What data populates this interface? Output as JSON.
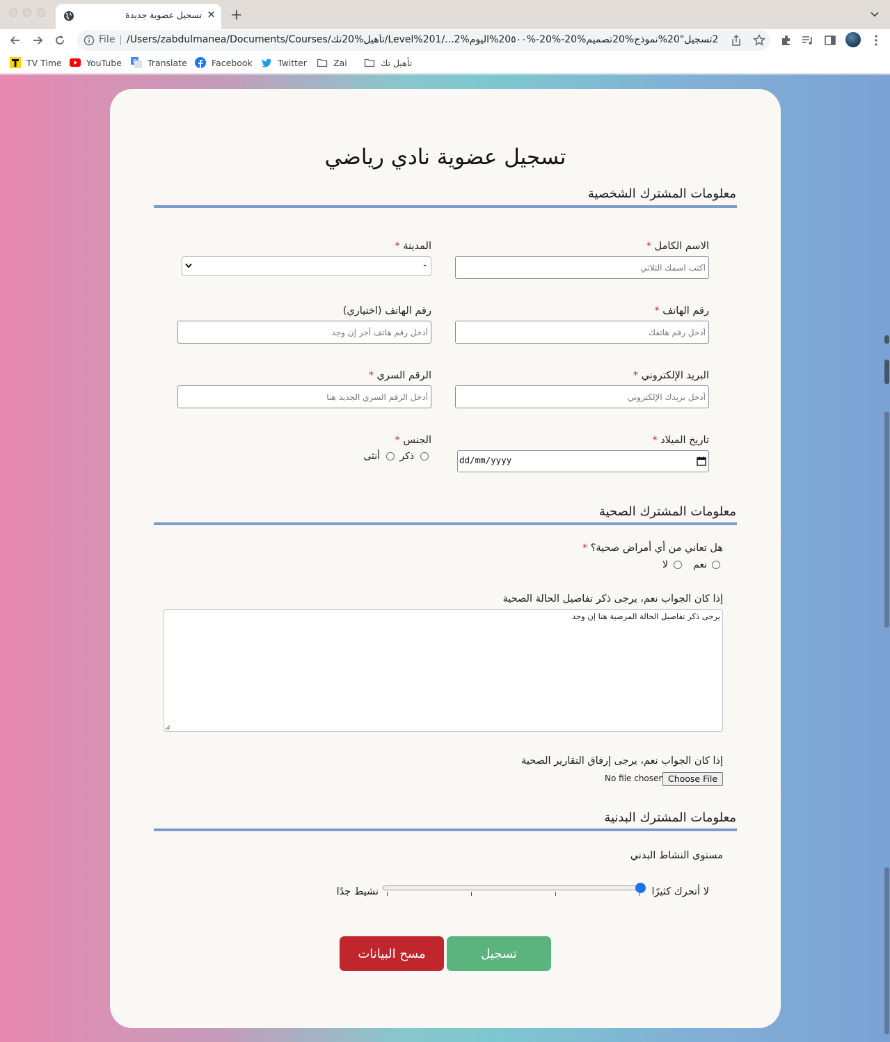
{
  "browser": {
    "tab_title": "تسجيل عضوية جديدة",
    "url_scheme": "File",
    "url": "/Users/zabdulmanea/Documents/Courses/تأهيل%20تك/Level%201/...2%عضوية%20تسجيل\"20%نموذج%20تصميم%20-%20-%20٥٠٠%اليوم",
    "bookmarks": [
      "TV Time",
      "YouTube",
      "Translate",
      "Facebook",
      "Twitter",
      "Zai",
      "تأهيل تك"
    ]
  },
  "form": {
    "title": "تسجيل عضوية نادي رياضي",
    "required_mark": "*",
    "personal": {
      "heading": "معلومات المشترك الشخصية",
      "full_name_label": "الاسم الكامل",
      "full_name_placeholder": "اكتب اسمك الثلاثي",
      "city_label": "المدينة",
      "city_value": "-",
      "phone_label": "رقم الهاتف",
      "phone_placeholder": "أدخل رقم هاتفك",
      "phone_alt_label": "رقم الهاتف (اختياري)",
      "phone_alt_placeholder": "أدخل رقم هاتف آخر إن وجد",
      "email_label": "البريد الإلكتروني",
      "email_placeholder": "أدخل بريدك الإلكتروني",
      "password_label": "الرقم السري",
      "password_placeholder": "أدخل الرقم السري الجديد هنا",
      "birthdate_label": "تاريخ الميلاد",
      "birthdate_value": "dd/mm/yyyy",
      "gender_label": "الجنس",
      "gender_options": [
        "ذكر",
        "أنثى"
      ]
    },
    "health": {
      "heading": "معلومات المشترك الصحية",
      "question": "هل تعاني من أي أمراض صحية؟",
      "options": [
        "نعم",
        "لا"
      ],
      "details_label": "إذا كان الجواب نعم، يرجى ذكر تفاصيل الحالة الصحية",
      "details_placeholder": "يرجى ذكر تفاصيل الحالة المرضية هنا إن وجد",
      "reports_label": "إذا كان الجواب نعم، يرجى إرفاق التقارير الصحية",
      "file_button": "Choose File",
      "file_status": "No file chosen"
    },
    "physical": {
      "heading": "معلومات المشترك البدنية",
      "activity_label": "مستوى النشاط البدني",
      "min_label": "لا أتحرك كثيرًا",
      "max_label": "نشيط جدًا",
      "slider_value": 0
    },
    "buttons": {
      "submit": "تسجيل",
      "clear": "مسح البيانات"
    }
  }
}
